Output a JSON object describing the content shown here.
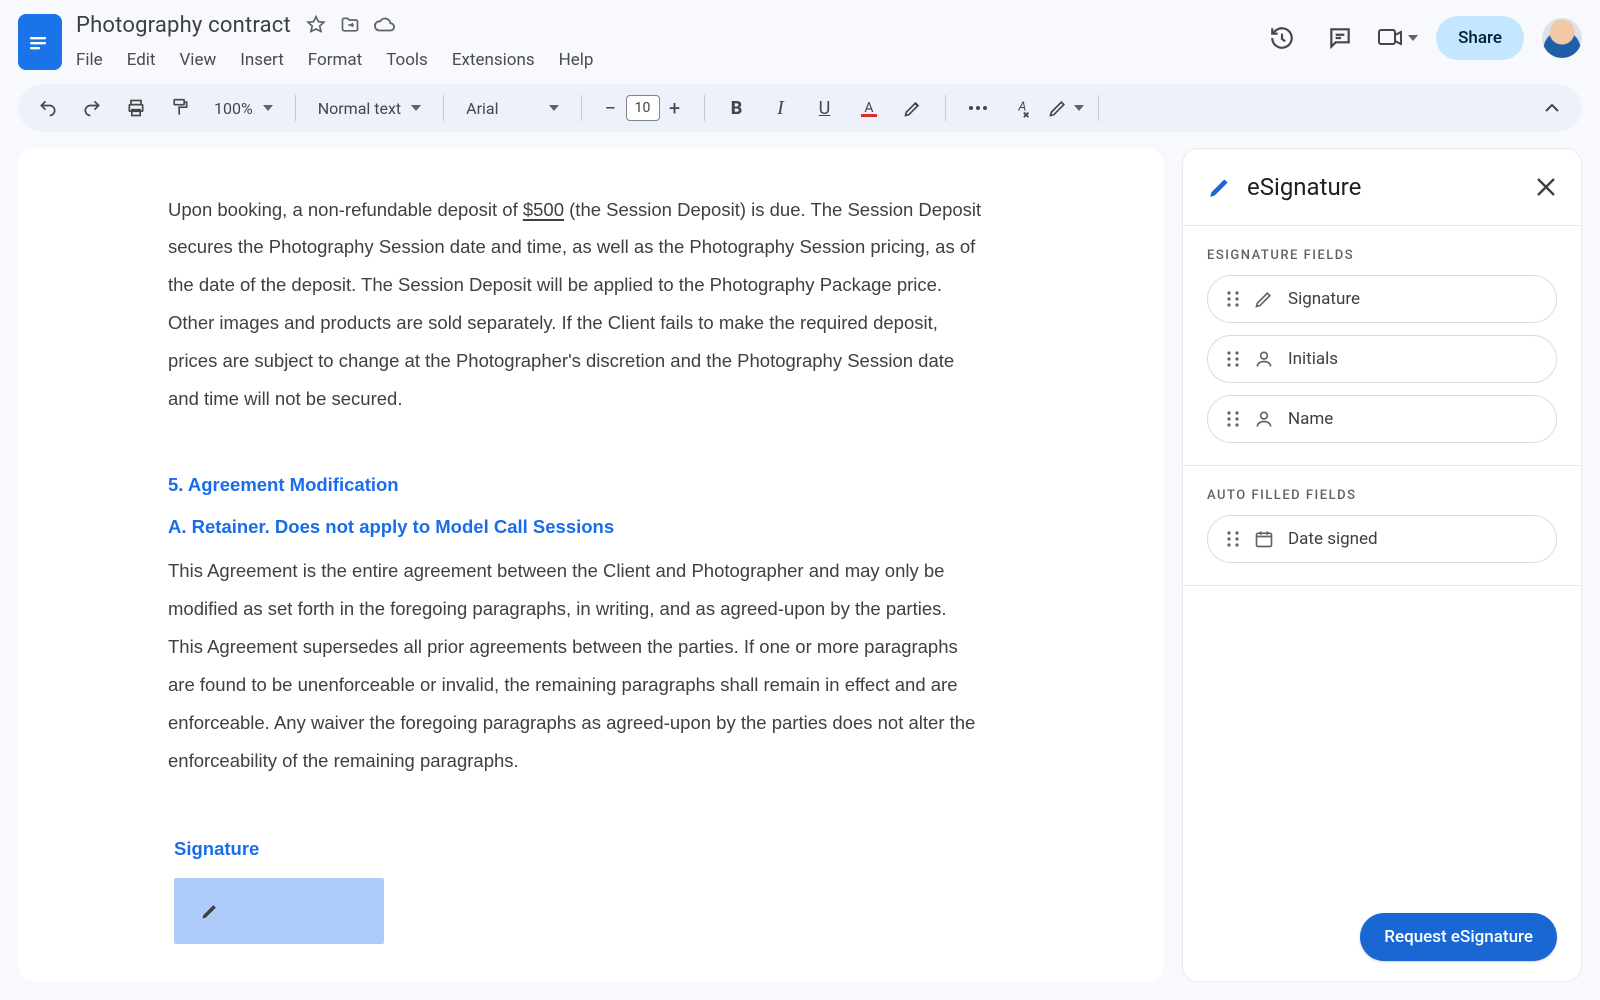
{
  "header": {
    "doc_title": "Photography contract",
    "menus": [
      "File",
      "Edit",
      "View",
      "Insert",
      "Format",
      "Tools",
      "Extensions",
      "Help"
    ],
    "share_label": "Share"
  },
  "toolbar": {
    "zoom": "100%",
    "style": "Normal text",
    "font": "Arial",
    "font_size": "10"
  },
  "document": {
    "para1_pre": "Upon booking, a non-refundable deposit of ",
    "para1_amount": "$500",
    "para1_post": " (the Session Deposit) is due. The Session Deposit secures the Photography Session date and time, as well as the Photography Session pricing, as of the date of the deposit. The Session Deposit will be applied to the Photography Package price. Other images and products are sold separately. If the Client fails to make the required deposit, prices are subject to change at the Photographer's discretion and the Photography Session date and time will not be secured.",
    "section5_title": "5. Agreement Modification",
    "section5_sub": "A. Retainer.  Does not apply to Model Call Sessions",
    "para2": "This Agreement is the entire agreement between the Client and Photographer and may only be modified as set forth in the foregoing paragraphs, in writing, and as agreed-upon by the parties.  This Agreement supersedes all prior agreements between the parties. If one or more paragraphs are found to be unenforceable or invalid, the remaining paragraphs shall remain in effect and are enforceable. Any waiver the foregoing paragraphs as agreed-upon by the parties does not alter the enforceability of the remaining paragraphs.",
    "signature_label": "Signature"
  },
  "panel": {
    "title": "eSignature",
    "sections": {
      "esig_fields_title": "ESIGNATURE FIELDS",
      "auto_fields_title": "AUTO FILLED FIELDS"
    },
    "esig_fields": {
      "signature": "Signature",
      "initials": "Initials",
      "name": "Name"
    },
    "auto_fields": {
      "date_signed": "Date signed"
    },
    "request_btn": "Request eSignature"
  }
}
